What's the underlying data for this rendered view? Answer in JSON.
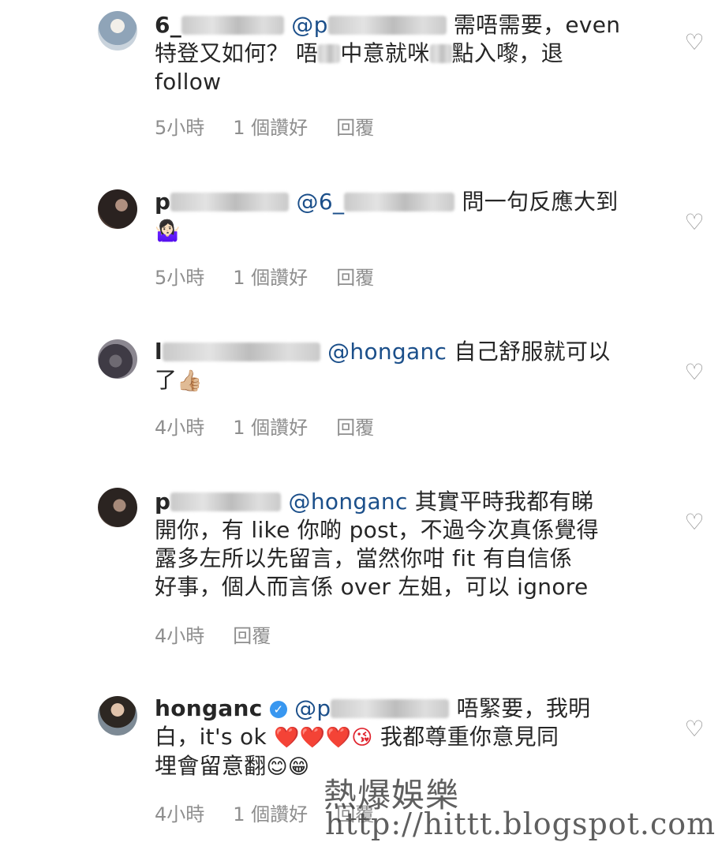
{
  "comments": [
    {
      "username": "6_",
      "mention": "@p",
      "text1": "需唔需要，even",
      "line2a": "特登又如何？ 唔",
      "line2b": "中意就咪",
      "line2c": "點入嚟，退",
      "line3": "follow",
      "time": "5小時",
      "likes": "1 個讚好",
      "reply": "回覆"
    },
    {
      "username": "p",
      "mention": "@6_",
      "text1": "問一句反應大到",
      "emoji": "🤷🏻‍♀️",
      "time": "5小時",
      "likes": "1 個讚好",
      "reply": "回覆"
    },
    {
      "username": "l",
      "mention": "@hongan c",
      "mention_text": "@honganc",
      "text1": "自己舒服就可以",
      "line2": "了",
      "emoji": "👍🏼",
      "time": "4小時",
      "likes": "1 個讚好",
      "reply": "回覆"
    },
    {
      "username": "p",
      "mention": "@honganc",
      "text1": "其實平時我都有睇",
      "line2": "開你，有 like 你啲 post，不過今次真係覺得",
      "line3": "露多左所以先留言，當然你咁 fit 有自信係",
      "line4": "好事，個人而言係 over 左姐，可以 ignore",
      "time": "4小時",
      "reply": "回覆"
    },
    {
      "username": "honganc",
      "mention": "@p",
      "text1": "唔緊要，我明",
      "line2a": "白，it's ok",
      "line2_emoji": "❤️❤️❤️😘",
      "line2b": "我都尊重你意見同",
      "line3": "埋會留意翻",
      "line3_emoji": "😊😁",
      "time": "4小時",
      "likes": "1 個讚好",
      "reply": "回覆"
    }
  ],
  "icons": {
    "like": "heart-outline-icon",
    "verified": "verified-badge-icon"
  },
  "watermark": {
    "line1": "熱爆娛樂",
    "line2": "http://hittt.blogspot.com"
  },
  "colors": {
    "mention": "#1b4f8a",
    "meta": "#8e8e8e",
    "verified": "#3897f0"
  }
}
